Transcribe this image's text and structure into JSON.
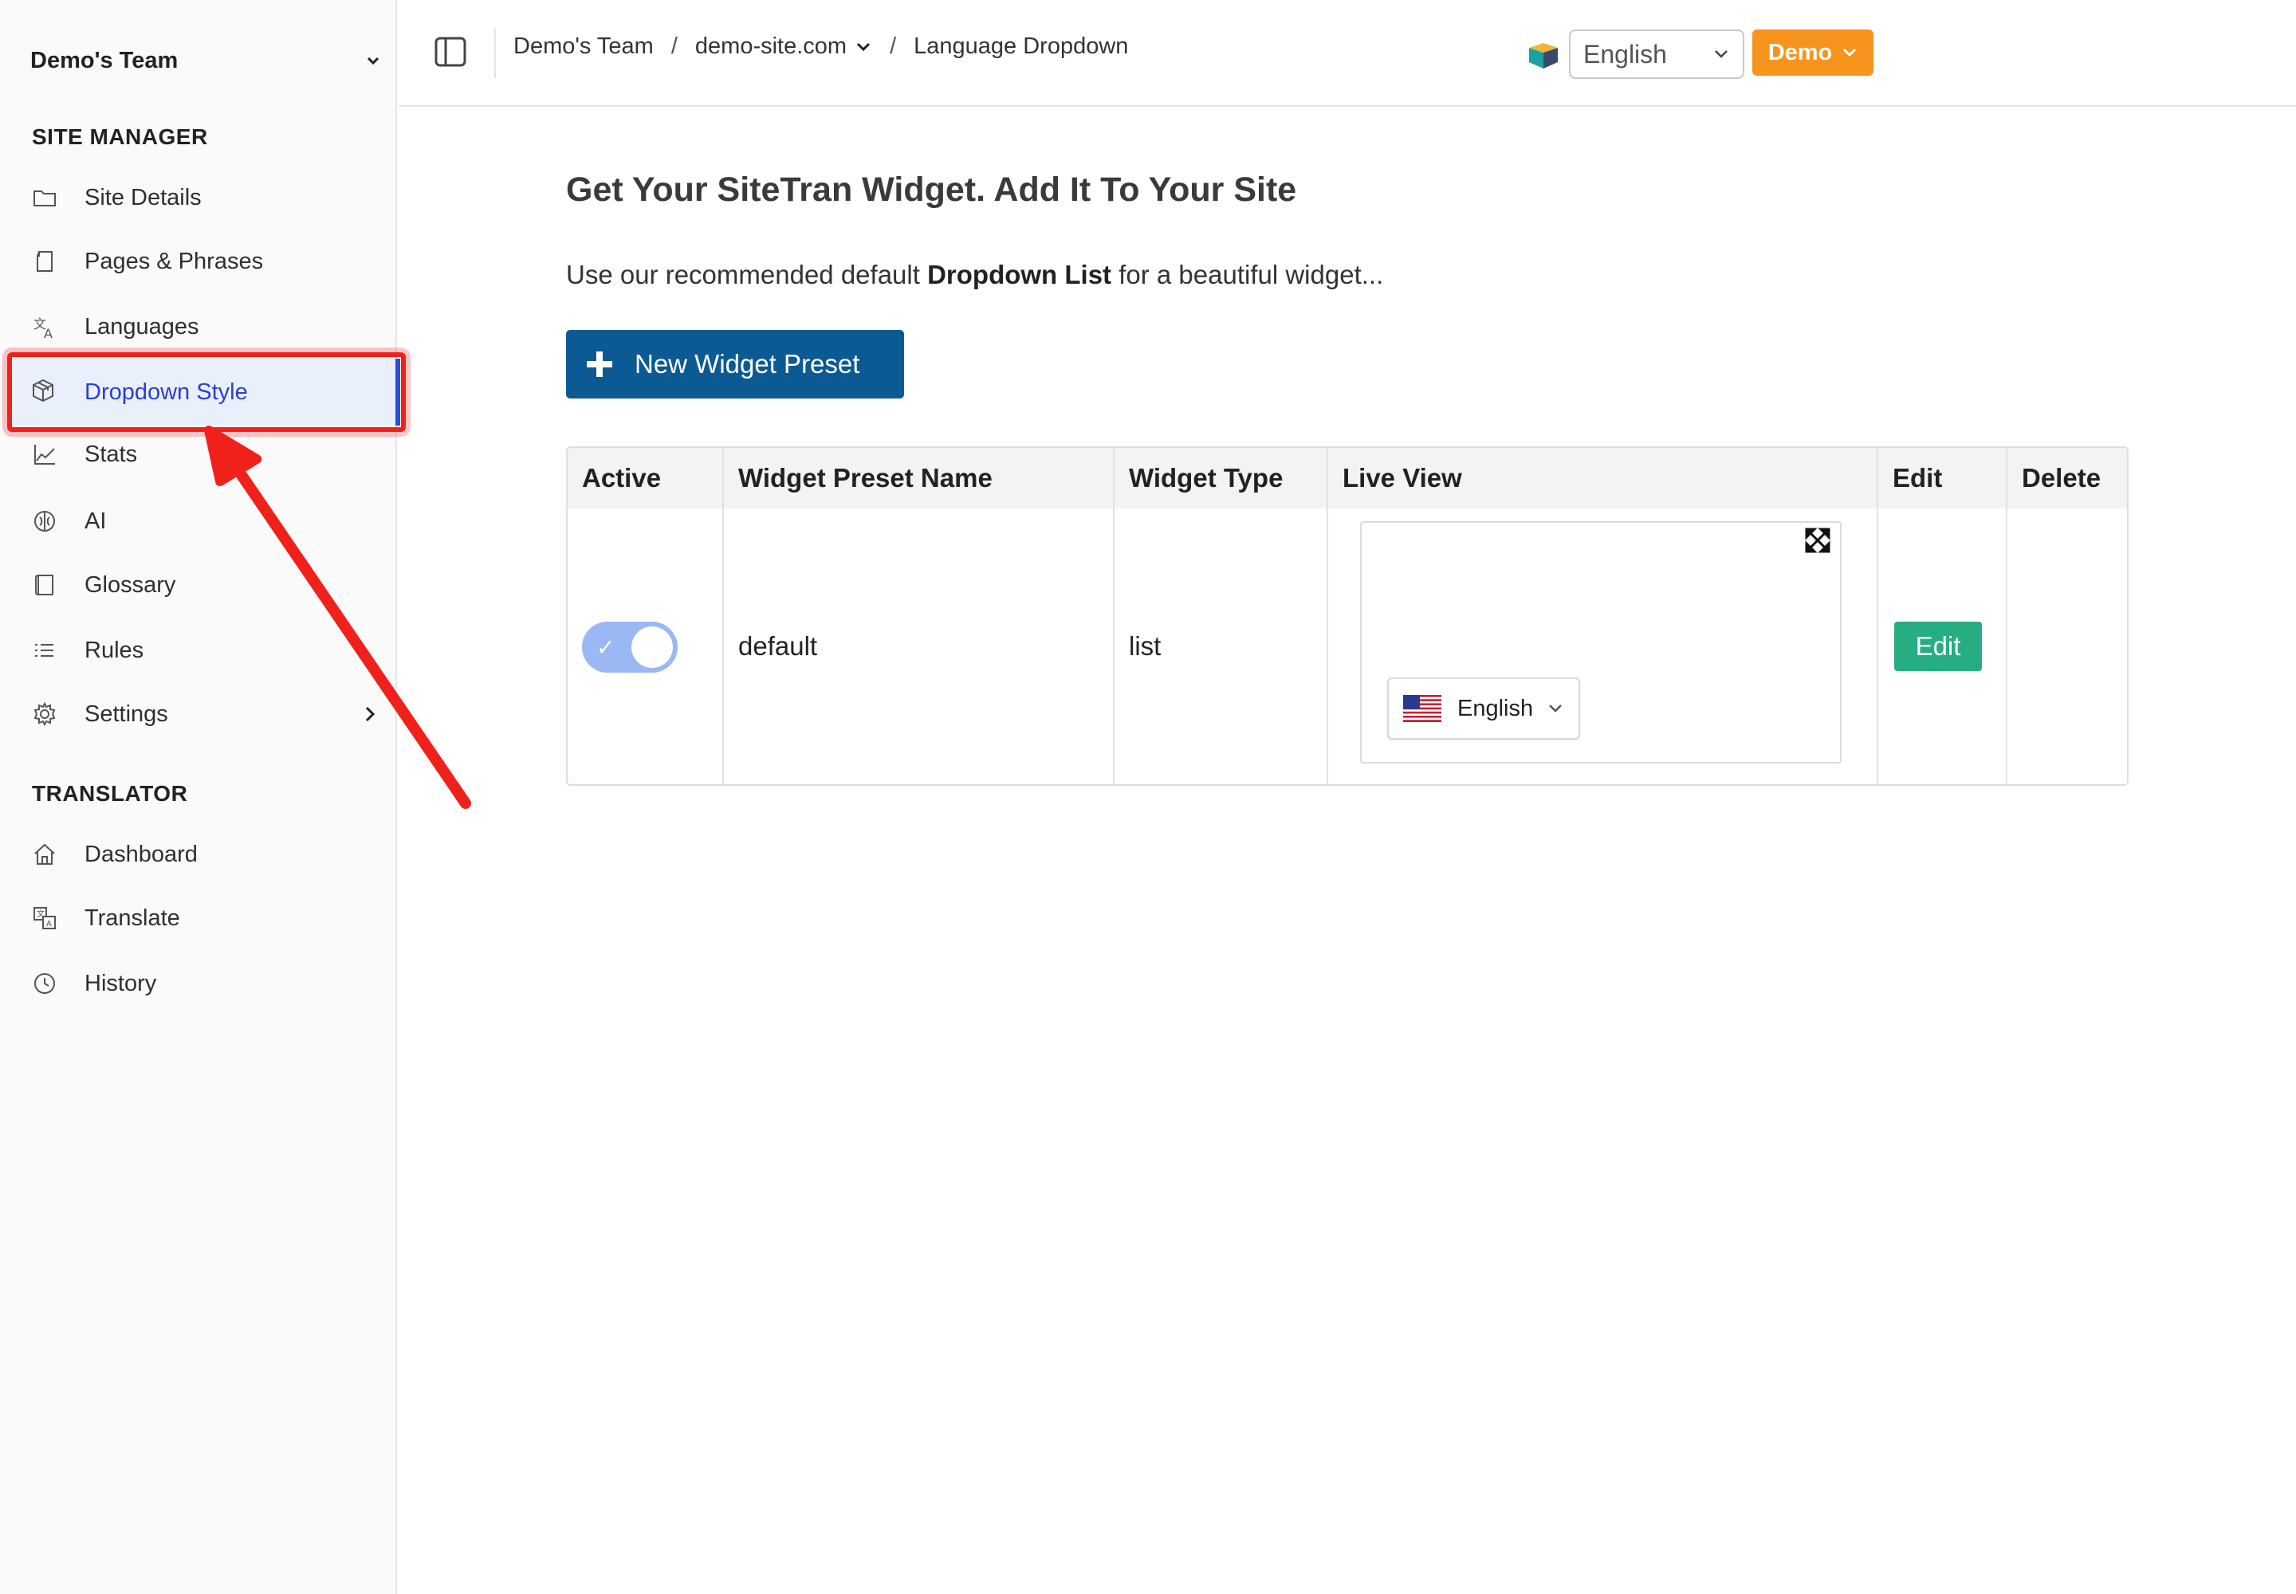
{
  "sidebar": {
    "team_name": "Demo's Team",
    "sections": {
      "site_manager": "SITE MANAGER",
      "translator": "TRANSLATOR"
    },
    "items": [
      {
        "label": "Site Details",
        "icon": "folder-icon"
      },
      {
        "label": "Pages & Phrases",
        "icon": "page-icon"
      },
      {
        "label": "Languages",
        "icon": "translate-icon"
      },
      {
        "label": "Dropdown Style",
        "icon": "cube-icon",
        "active": true
      },
      {
        "label": "Stats",
        "icon": "chart-line-icon"
      },
      {
        "label": "AI",
        "icon": "brain-icon"
      },
      {
        "label": "Glossary",
        "icon": "book-icon"
      },
      {
        "label": "Rules",
        "icon": "list-check-icon"
      },
      {
        "label": "Settings",
        "icon": "gear-icon"
      }
    ],
    "translator_items": [
      {
        "label": "Dashboard",
        "icon": "home-icon"
      },
      {
        "label": "Translate",
        "icon": "translate-doc-icon"
      },
      {
        "label": "History",
        "icon": "clock-icon"
      }
    ]
  },
  "topbar": {
    "breadcrumb": {
      "team": "Demo's Team",
      "site": "demo-site.com",
      "page": "Language Dropdown"
    },
    "language_select": "English",
    "demo_button": "Demo"
  },
  "main": {
    "title": "Get Your SiteTran Widget. Add It To Your Site",
    "subtitle_pre": "Use our recommended default ",
    "subtitle_bold": "Dropdown List",
    "subtitle_post": " for a beautiful widget...",
    "new_button": "New Widget Preset",
    "table": {
      "headers": [
        "Active",
        "Widget Preset Name",
        "Widget Type",
        "Live View",
        "Edit",
        "Delete"
      ],
      "rows": [
        {
          "active": true,
          "name": "default",
          "type": "list",
          "live_language": "English",
          "edit_label": "Edit"
        }
      ]
    }
  },
  "colors": {
    "accent_blue": "#0b5a93",
    "demo_orange": "#f7941d",
    "edit_green": "#26ad82",
    "active_nav_text": "#2b3fd0",
    "highlight_red": "#f0211b"
  }
}
